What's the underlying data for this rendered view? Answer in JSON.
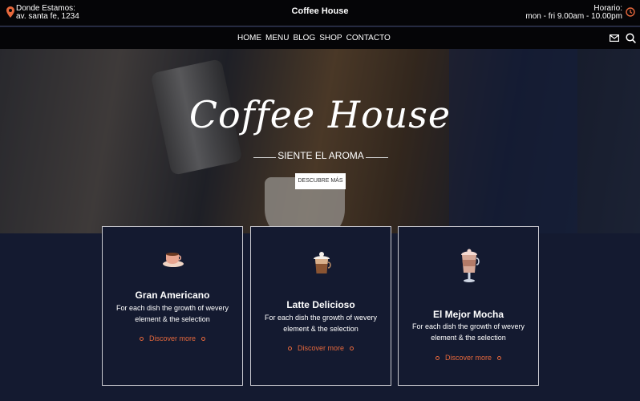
{
  "topbar": {
    "location_label": "Donde Estamos:",
    "location_value": "av. santa fe, 1234",
    "brand": "Coffee House",
    "hours_label": "Horario:",
    "hours_value": "mon - fri 9.00am - 10.00pm"
  },
  "nav": {
    "items": [
      "HOME",
      "MENU",
      "BLOG",
      "SHOP",
      "CONTACTO"
    ],
    "icons": [
      "mail-icon",
      "search-icon"
    ]
  },
  "hero": {
    "title": "Coffee House",
    "subtitle": "SIENTE EL AROMA",
    "button": "DESCUBRE MÁS"
  },
  "cards": [
    {
      "name": "Gran Americano",
      "desc": "For each dish the growth of wevery element & the selection",
      "more": "Discover more",
      "icon": "coffee-cup-icon"
    },
    {
      "name": "Latte Delicioso",
      "desc": "For each dish the growth of wevery element & the selection",
      "more": "Discover more",
      "icon": "latte-icon"
    },
    {
      "name": "El Mejor Mocha",
      "desc": "For each dish the growth of wevery element & the selection",
      "more": "Discover more",
      "icon": "mocha-icon"
    }
  ],
  "colors": {
    "accent": "#e6683c",
    "background": "#141a30",
    "bar": "#050507"
  }
}
